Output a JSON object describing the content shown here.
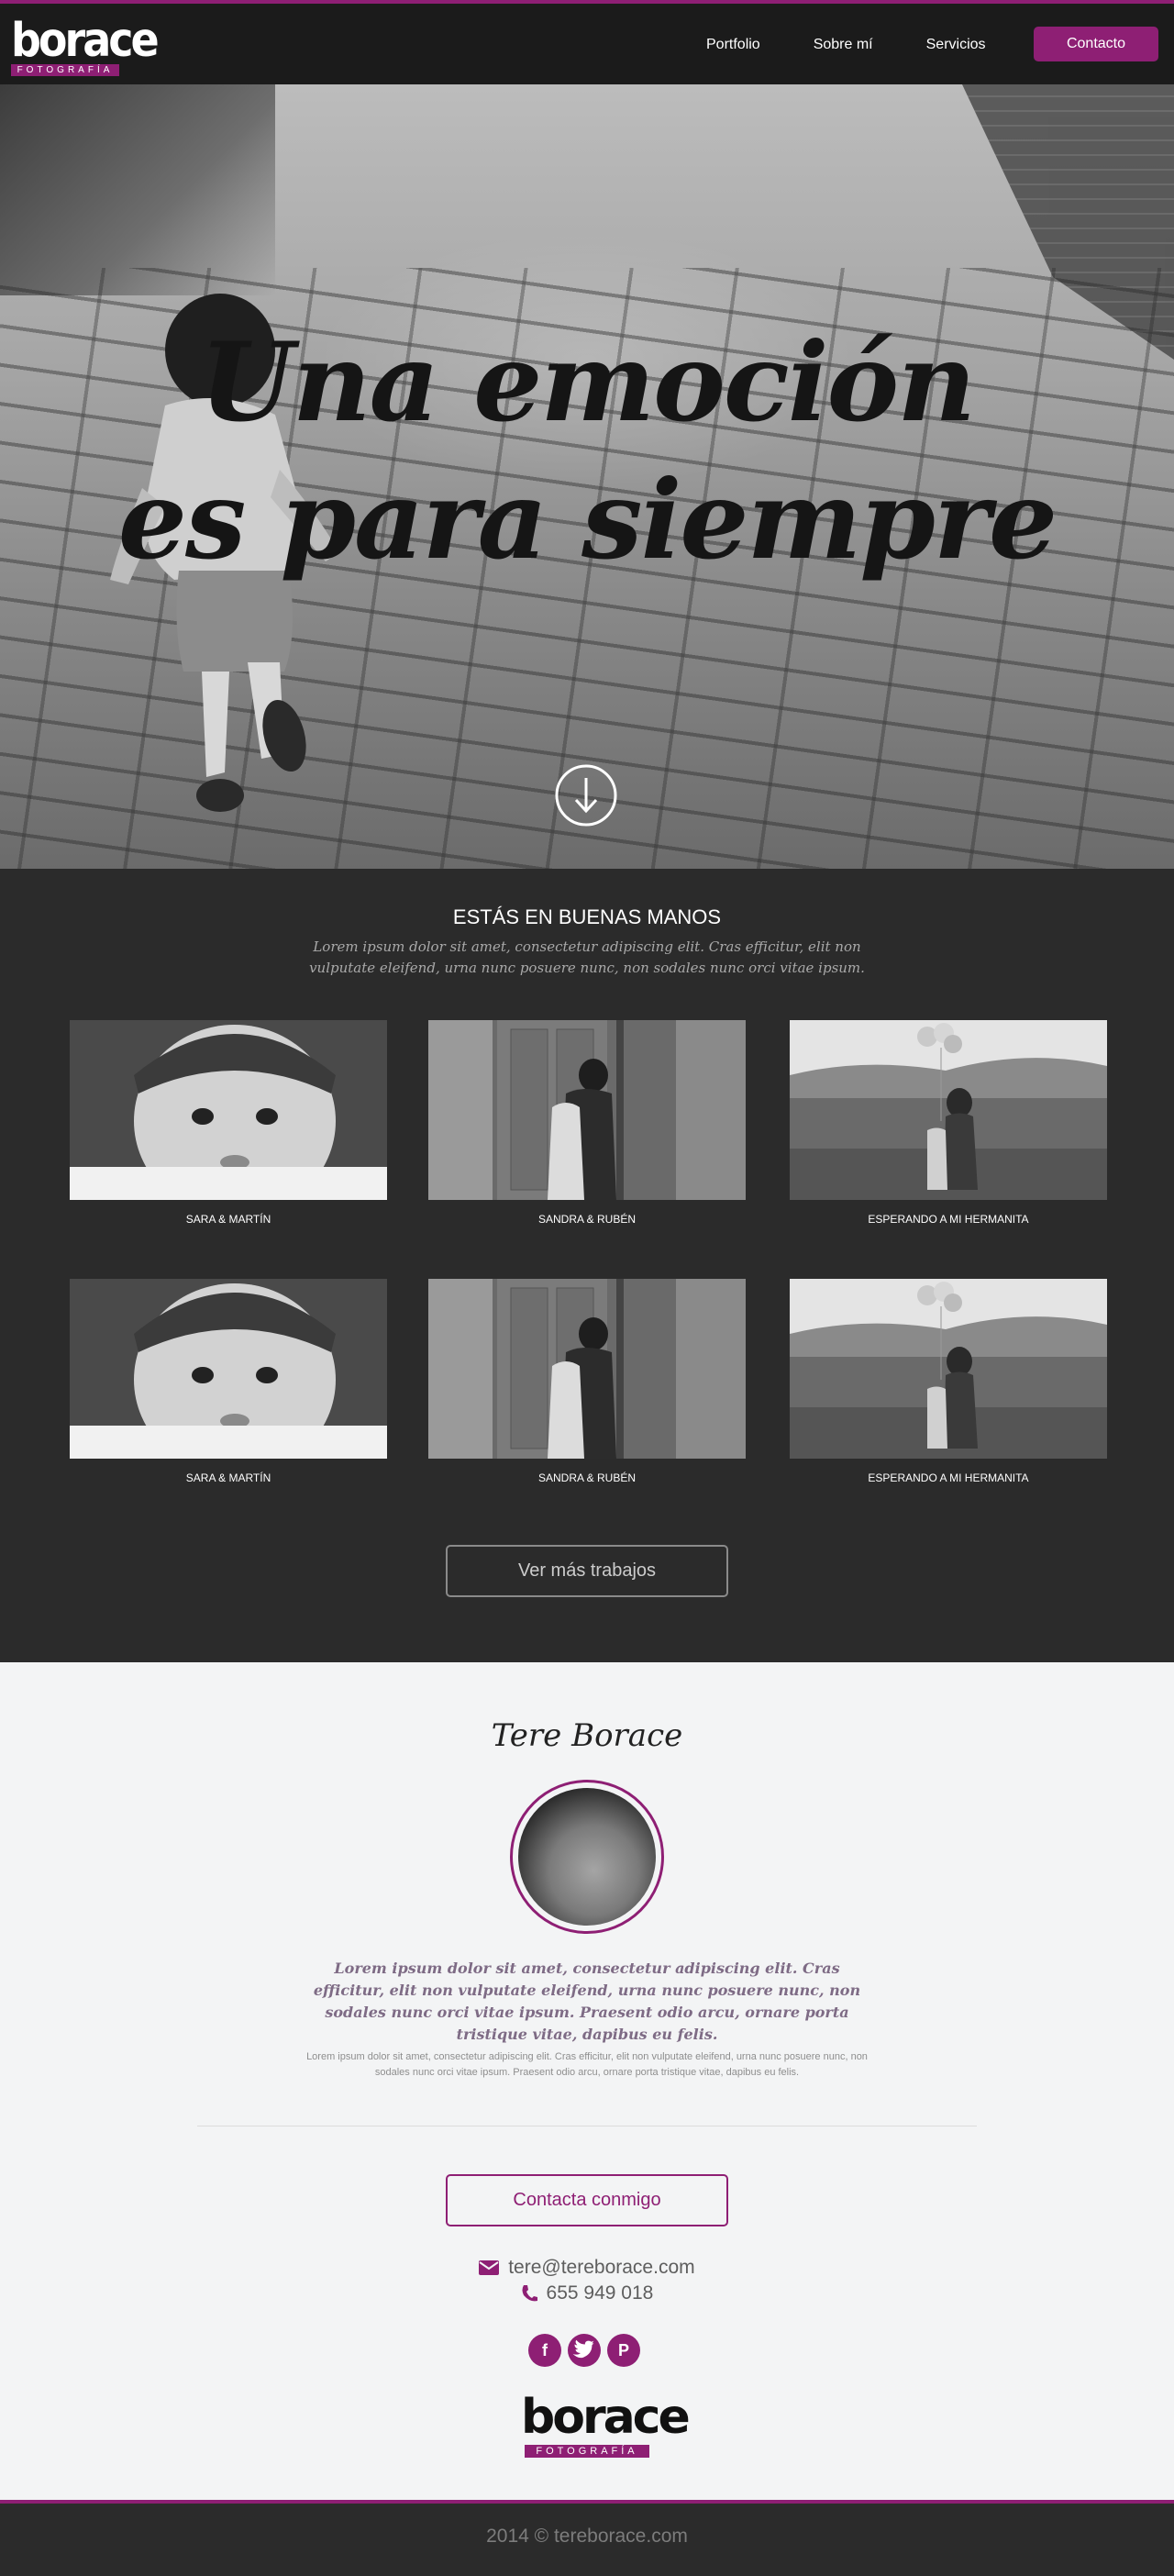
{
  "brand": {
    "name": "borace",
    "tagline": "FOTOGRAFÍA"
  },
  "nav": {
    "items": [
      "Portfolio",
      "Sobre mí",
      "Servicios"
    ],
    "cta": "Contacto"
  },
  "hero": {
    "line1": "Una emoción",
    "line2": "es para siempre",
    "scroll_icon": "arrow-down-circle-icon"
  },
  "works": {
    "title": "ESTÁS EN BUENAS MANOS",
    "intro": "Lorem ipsum dolor sit amet, consectetur adipiscing elit. Cras efficitur, elit non vulputate eleifend, urna nunc posuere nunc, non sodales nunc orci vitae ipsum.",
    "items": [
      {
        "caption": "SARA & MARTÍN"
      },
      {
        "caption": "SANDRA & RUBÉN"
      },
      {
        "caption": "ESPERANDO A MI HERMANITA"
      },
      {
        "caption": "SARA & MARTÍN"
      },
      {
        "caption": "SANDRA & RUBÉN"
      },
      {
        "caption": "ESPERANDO A MI HERMANITA"
      }
    ],
    "more_button": "Ver más trabajos"
  },
  "about": {
    "name": "Tere Borace",
    "quote": "Lorem ipsum dolor sit amet, consectetur adipiscing elit. Cras efficitur, elit non vulputate eleifend, urna nunc posuere nunc, non sodales nunc orci vitae ipsum. Praesent odio arcu, ornare porta tristique vitae, dapibus eu felis.",
    "body": "Lorem ipsum dolor sit amet, consectetur adipiscing elit. Cras efficitur, elit non vulputate eleifend, urna nunc posuere nunc, non sodales nunc orci vitae ipsum. Praesent odio arcu, ornare porta tristique vitae, dapibus eu felis.",
    "contact_button": "Contacta conmigo",
    "email": "tere@tereborace.com",
    "phone": "655 949 018",
    "socials": [
      "facebook-icon",
      "twitter-icon",
      "pinterest-icon"
    ]
  },
  "footer": {
    "copyright": "2014 © tereborace.com"
  },
  "colors": {
    "accent": "#8e1f74",
    "dark": "#2b2b2b",
    "light": "#f3f4f5"
  }
}
